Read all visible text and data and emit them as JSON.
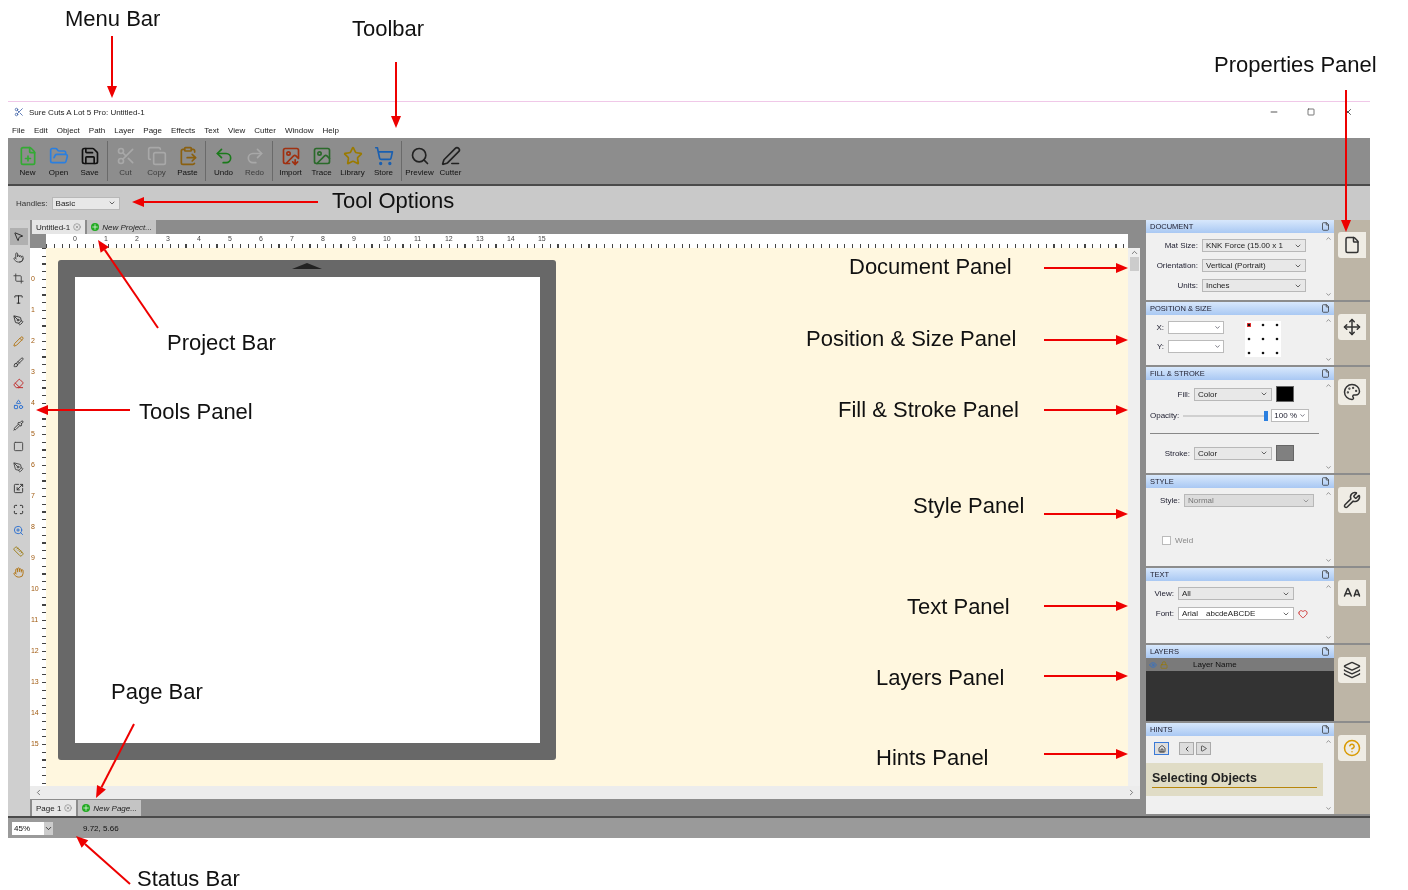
{
  "annotations": [
    {
      "label": "Menu Bar"
    },
    {
      "label": "Toolbar"
    },
    {
      "label": "Properties Panel"
    },
    {
      "label": "Tool Options"
    },
    {
      "label": "Project Bar"
    },
    {
      "label": "Tools Panel"
    },
    {
      "label": "Page Bar"
    },
    {
      "label": "Status Bar"
    },
    {
      "label": "Document Panel"
    },
    {
      "label": "Position & Size Panel"
    },
    {
      "label": "Fill & Stroke Panel"
    },
    {
      "label": "Style Panel"
    },
    {
      "label": "Text Panel"
    },
    {
      "label": "Layers Panel"
    },
    {
      "label": "Hints Panel"
    }
  ],
  "window": {
    "title": "Sure Cuts A Lot 5 Pro: Untitled-1"
  },
  "menu": [
    "File",
    "Edit",
    "Object",
    "Path",
    "Layer",
    "Page",
    "Effects",
    "Text",
    "View",
    "Cutter",
    "Window",
    "Help"
  ],
  "toolbar": [
    [
      {
        "label": "New",
        "disabled": false
      },
      {
        "label": "Open",
        "disabled": false
      },
      {
        "label": "Save",
        "disabled": false
      }
    ],
    [
      {
        "label": "Cut",
        "disabled": true
      },
      {
        "label": "Copy",
        "disabled": true
      },
      {
        "label": "Paste",
        "disabled": false
      }
    ],
    [
      {
        "label": "Undo",
        "disabled": false
      },
      {
        "label": "Redo",
        "disabled": true
      }
    ],
    [
      {
        "label": "Import",
        "disabled": false
      },
      {
        "label": "Trace",
        "disabled": false
      },
      {
        "label": "Library",
        "disabled": false
      },
      {
        "label": "Store",
        "disabled": false
      }
    ],
    [
      {
        "label": "Preview",
        "disabled": false
      },
      {
        "label": "Cutter",
        "disabled": false
      }
    ]
  ],
  "tool_options": {
    "label": "Handles:",
    "value": "Basic"
  },
  "project_tabs": [
    {
      "label": "Untitled-1",
      "kind": "tab",
      "selected": true
    },
    {
      "label": "New Project...",
      "kind": "add",
      "selected": false
    }
  ],
  "rulers": {
    "horizontal": [
      "0",
      "1",
      "2",
      "3",
      "4",
      "5",
      "6",
      "7",
      "8",
      "9",
      "10",
      "11",
      "12",
      "13",
      "14",
      "15"
    ],
    "vertical": [
      "0",
      "1",
      "2",
      "3",
      "4",
      "5",
      "6",
      "7",
      "8",
      "9",
      "10",
      "11",
      "12",
      "13",
      "14",
      "15"
    ]
  },
  "page_tabs": [
    {
      "label": "Page 1",
      "kind": "tab",
      "selected": true
    },
    {
      "label": "New Page...",
      "kind": "add",
      "selected": false
    }
  ],
  "panels": [
    {
      "kind": "document",
      "title": "DOCUMENT",
      "fields": [
        {
          "label": "Mat Size:",
          "value": "KNK Force (15.00 x 1"
        },
        {
          "label": "Orientation:",
          "value": "Vertical (Portrait)"
        },
        {
          "label": "Units:",
          "value": "Inches"
        }
      ]
    },
    {
      "kind": "position",
      "title": "POSITION & SIZE",
      "fields": [
        {
          "label": "X:"
        },
        {
          "label": "Y:"
        }
      ]
    },
    {
      "kind": "fill",
      "title": "FILL & STROKE",
      "fill": {
        "label": "Fill:",
        "value": "Color",
        "color": "#000000"
      },
      "opacity": {
        "label": "Opacity:",
        "level": 0.98,
        "reading": "100 %"
      },
      "stroke": {
        "label": "Stroke:",
        "value": "Color",
        "color": "#808080"
      }
    },
    {
      "kind": "style",
      "title": "STYLE",
      "style": {
        "label": "Style:",
        "value": "Normal",
        "disabled": true
      },
      "weld": {
        "label": "Weld",
        "checked": false,
        "disabled": true
      }
    },
    {
      "kind": "text",
      "title": "TEXT",
      "view": {
        "label": "View:",
        "value": "All"
      },
      "font": {
        "label": "Font:",
        "name": "Arial",
        "sample": "abcdeABCDE"
      }
    },
    {
      "kind": "layers",
      "title": "LAYERS",
      "column": "Layer Name"
    },
    {
      "kind": "hints",
      "title": "HINTS",
      "heading": "Selecting Objects"
    }
  ],
  "status": {
    "zoom": "45%",
    "coordinates": "9.72, 5.66"
  }
}
